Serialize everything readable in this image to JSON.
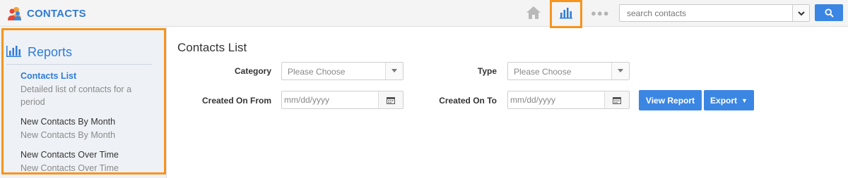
{
  "app": {
    "title": "CONTACTS"
  },
  "header": {
    "search": {
      "placeholder": "search contacts"
    }
  },
  "sidebar": {
    "title": "Reports",
    "items": [
      {
        "label": "Contacts List",
        "description": "Detailed list of contacts for a period",
        "active": true
      },
      {
        "label": "New Contacts By Month",
        "description": "New Contacts By Month",
        "active": false
      },
      {
        "label": "New Contacts Over Time",
        "description": "New Contacts Over Time",
        "active": false
      }
    ]
  },
  "main": {
    "title": "Contacts List",
    "filters": {
      "category_label": "Category",
      "category_value": "Please Choose",
      "type_label": "Type",
      "type_value": "Please Choose",
      "created_from_label": "Created On From",
      "created_from_placeholder": "mm/dd/yyyy",
      "created_to_label": "Created On To",
      "created_to_placeholder": "mm/dd/yyyy"
    },
    "actions": {
      "view_report": "View Report",
      "export": "Export"
    }
  },
  "colors": {
    "accent": "#2f7bd8",
    "button": "#3b86e3",
    "highlight": "#f7941d"
  }
}
